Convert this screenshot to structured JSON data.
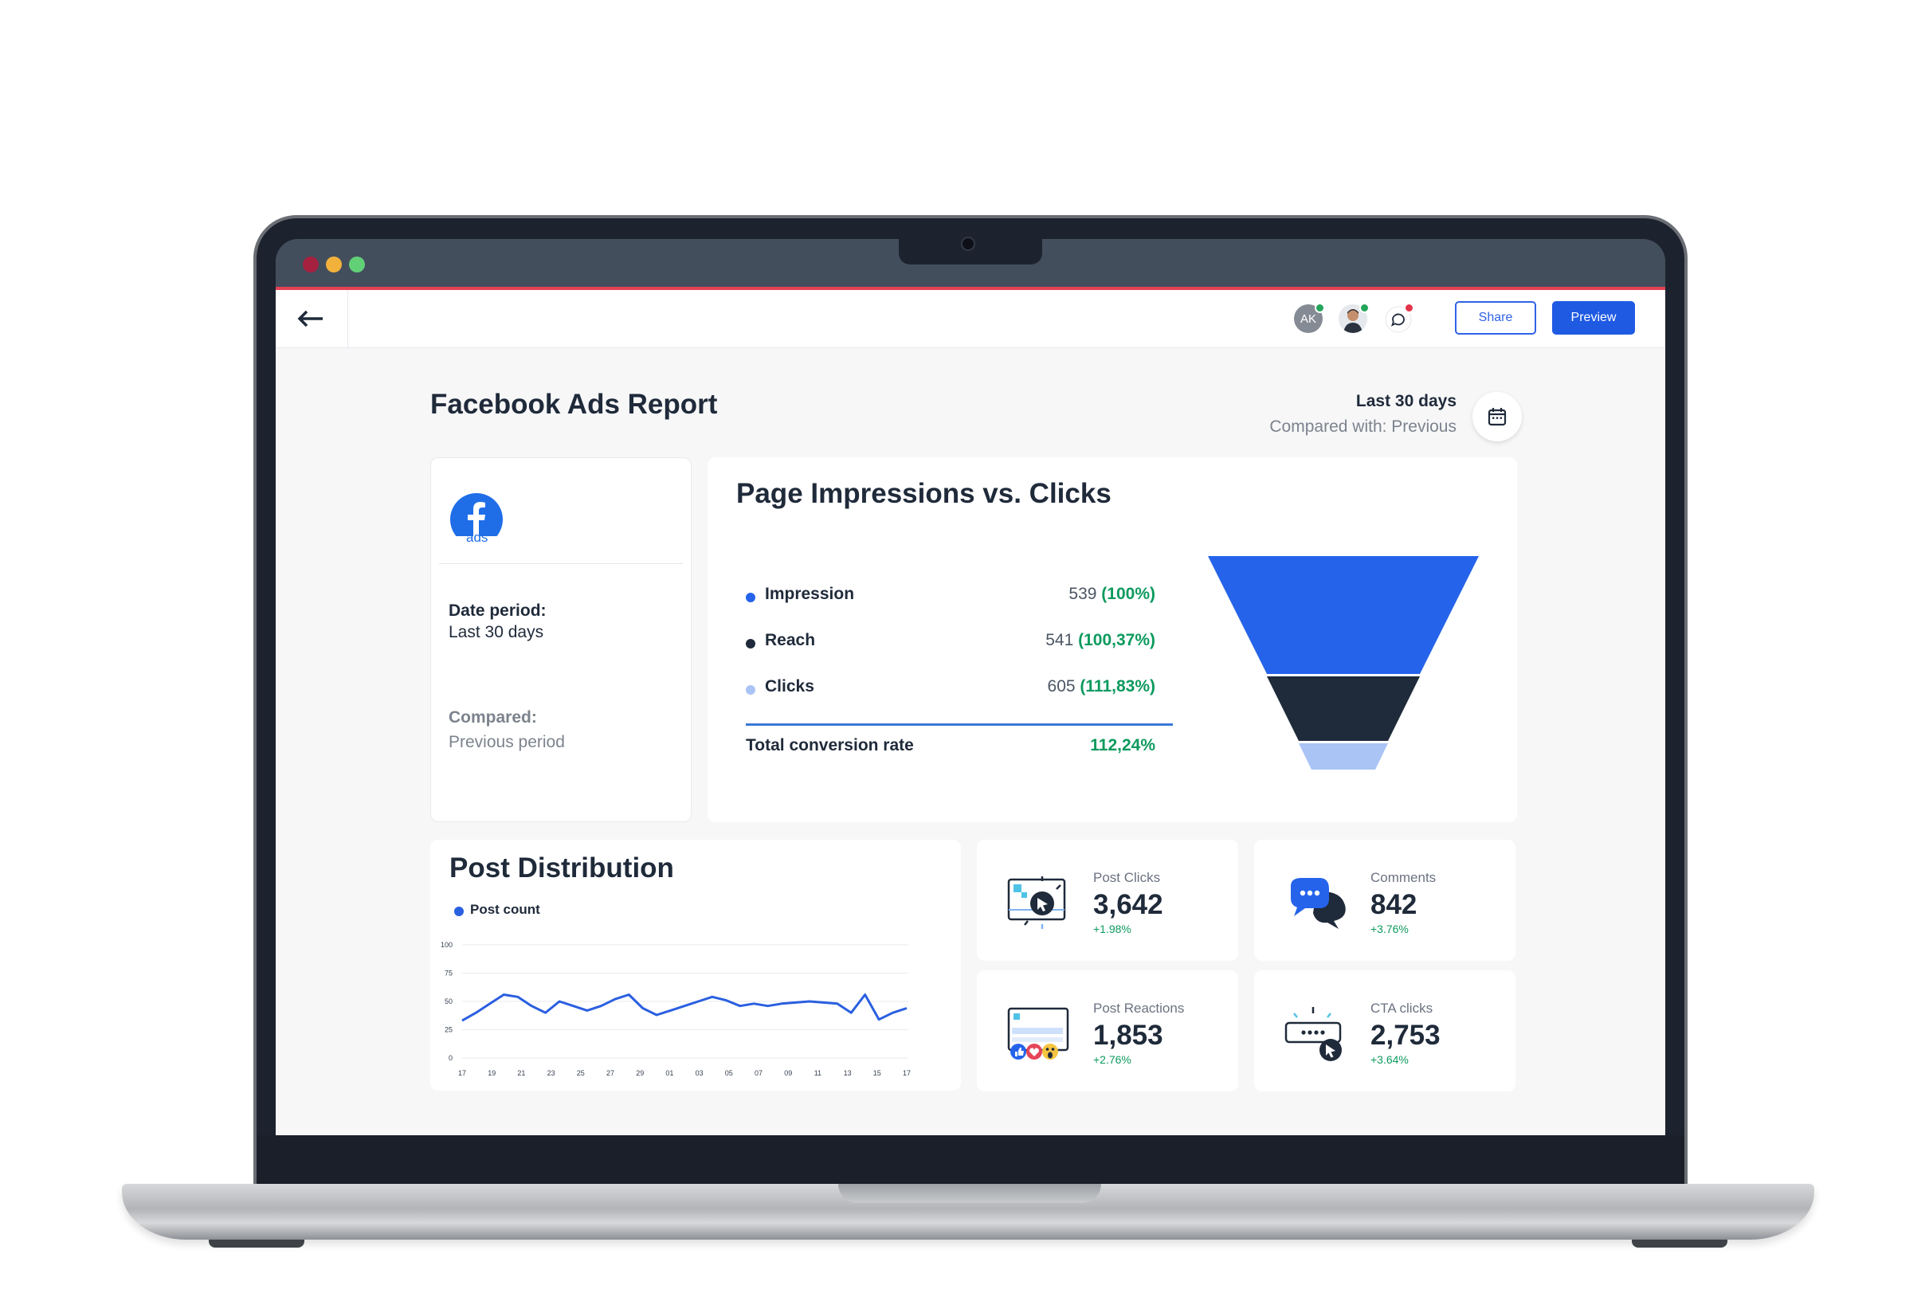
{
  "window": {
    "controls": [
      "close",
      "minimize",
      "maximize"
    ]
  },
  "header": {
    "back_icon": "arrow-left-icon",
    "avatar_initials": "AK",
    "chat_icon": "chat-icon",
    "share_label": "Share",
    "preview_label": "Preview"
  },
  "report": {
    "title": "Facebook Ads Report",
    "date_range": "Last 30 days",
    "compared_with": "Compared with: Previous",
    "calendar_icon": "calendar-icon"
  },
  "info_card": {
    "logo_text": "ads",
    "date_period_label": "Date period:",
    "date_period_value": "Last 30 days",
    "compared_label": "Compared:",
    "compared_value": "Previous period"
  },
  "funnel": {
    "title": "Page Impressions vs. Clicks",
    "rows": [
      {
        "label": "Impression",
        "value": "539",
        "pct": "(100%)",
        "color": "#2563eb"
      },
      {
        "label": "Reach",
        "value": "541",
        "pct": "(100,37%)",
        "color": "#1f2a3a"
      },
      {
        "label": "Clicks",
        "value": "605",
        "pct": "(111,83%)",
        "color": "#a9c4f5"
      }
    ],
    "total_label": "Total conversion rate",
    "total_value": "112,24%"
  },
  "post_distribution": {
    "title": "Post Distribution",
    "legend": "Post count"
  },
  "chart_data": {
    "type": "line",
    "title": "Post Distribution",
    "series": [
      {
        "name": "Post count",
        "color": "#2a5fe0",
        "values": [
          33,
          40,
          48,
          56,
          54,
          46,
          40,
          50,
          46,
          42,
          46,
          52,
          56,
          44,
          38,
          42,
          46,
          50,
          54,
          51,
          46,
          48,
          46,
          48,
          49,
          50,
          49,
          48,
          40,
          56,
          34,
          40,
          44
        ]
      }
    ],
    "x_tick_labels": [
      "17",
      "19",
      "21",
      "23",
      "25",
      "27",
      "29",
      "01",
      "03",
      "05",
      "07",
      "09",
      "11",
      "13",
      "15",
      "17"
    ],
    "y_ticks": [
      0,
      25,
      50,
      75,
      100
    ],
    "ylim": [
      0,
      100
    ],
    "grid": true
  },
  "kpis": [
    {
      "label": "Post Clicks",
      "value": "3,642",
      "change": "+1.98%",
      "icon": "cursor-click-icon"
    },
    {
      "label": "Comments",
      "value": "842",
      "change": "+3.76%",
      "icon": "speech-bubbles-icon"
    },
    {
      "label": "Post Reactions",
      "value": "1,853",
      "change": "+2.76%",
      "icon": "reactions-icon"
    },
    {
      "label": "CTA clicks",
      "value": "2,753",
      "change": "+3.64%",
      "icon": "cta-cursor-icon"
    }
  ]
}
